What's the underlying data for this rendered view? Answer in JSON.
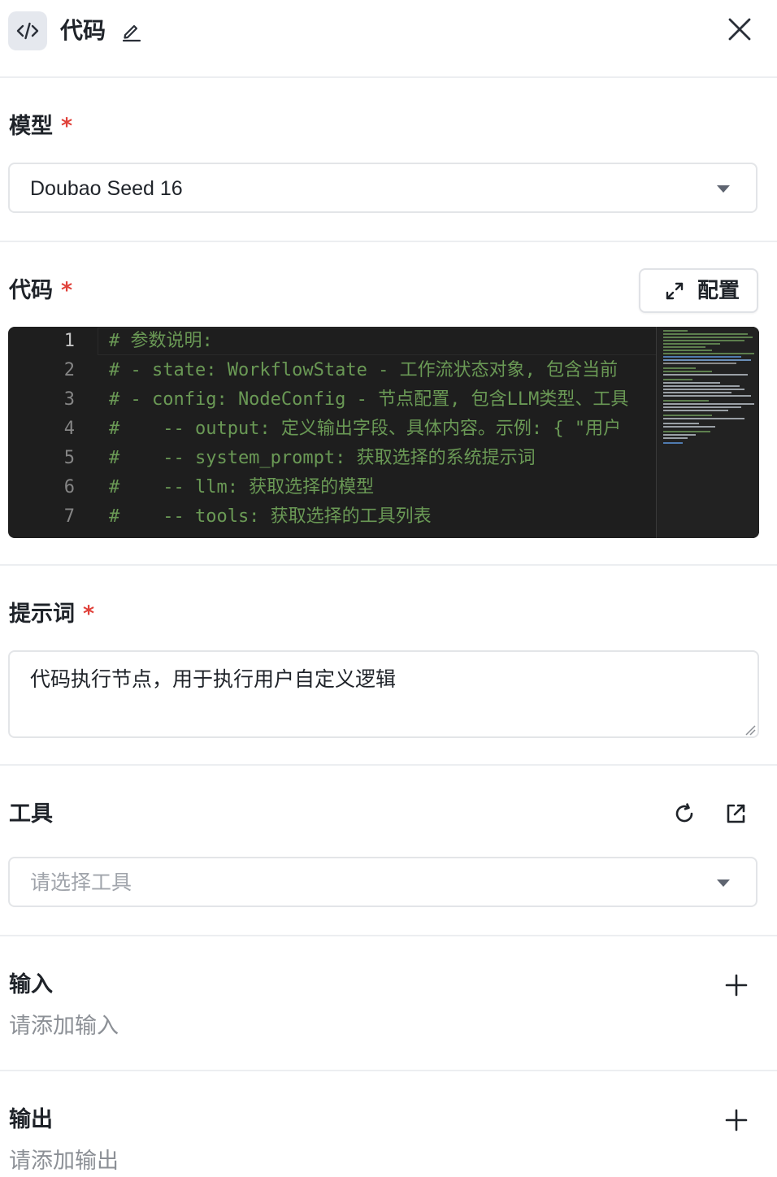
{
  "header": {
    "title": "代码"
  },
  "model": {
    "label": "模型",
    "required": "*",
    "value": "Doubao Seed 16"
  },
  "code": {
    "label": "代码",
    "required": "*",
    "config_label": "配置",
    "line_numbers": [
      "1",
      "2",
      "3",
      "4",
      "5",
      "6",
      "7"
    ],
    "lines": [
      "# 参数说明:",
      "# - state: WorkflowState - 工作流状态对象, 包含当前",
      "# - config: NodeConfig - 节点配置, 包含LLM类型、工具",
      "#    -- output: 定义输出字段、具体内容。示例: { \"用户",
      "#    -- system_prompt: 获取选择的系统提示词",
      "#    -- llm: 获取选择的模型",
      "#    -- tools: 获取选择的工具列表"
    ]
  },
  "prompt": {
    "label": "提示词",
    "required": "*",
    "value": "代码执行节点，用于执行用户自定义逻辑"
  },
  "tools": {
    "label": "工具",
    "placeholder": "请选择工具"
  },
  "inputs": {
    "label": "输入",
    "empty": "请添加输入"
  },
  "outputs": {
    "label": "输出",
    "empty": "请添加输出"
  },
  "colors": {
    "accent_required": "#e0413a",
    "code_comment": "#6a9955",
    "editor_bg": "#1e1e1e"
  }
}
